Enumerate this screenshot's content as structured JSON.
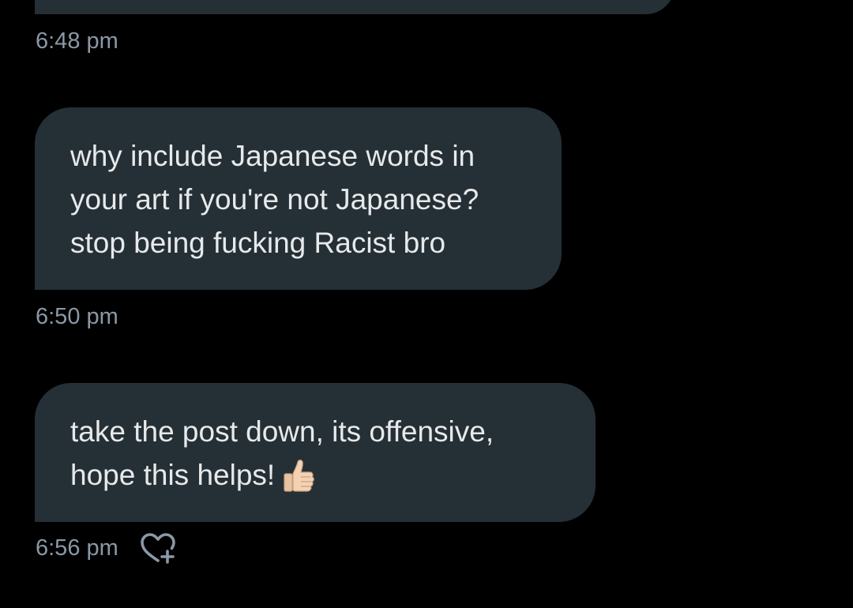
{
  "messages": [
    {
      "text_lines": [],
      "time": "6:48 pm"
    },
    {
      "text_lines": [
        "why include Japanese words in",
        "your art if you're not Japanese?",
        "stop being fucking Racist bro"
      ],
      "time": "6:50 pm"
    },
    {
      "text_lines": [
        "take the post down, its offensive,",
        "hope this helps!"
      ],
      "emoji": "thumbs-up",
      "time": "6:56 pm",
      "reaction_icon": "heart-plus-icon"
    }
  ],
  "colors": {
    "background": "#000000",
    "bubble": "#253036",
    "message_text": "#e7e9ea",
    "timestamp": "#8b98a5"
  }
}
